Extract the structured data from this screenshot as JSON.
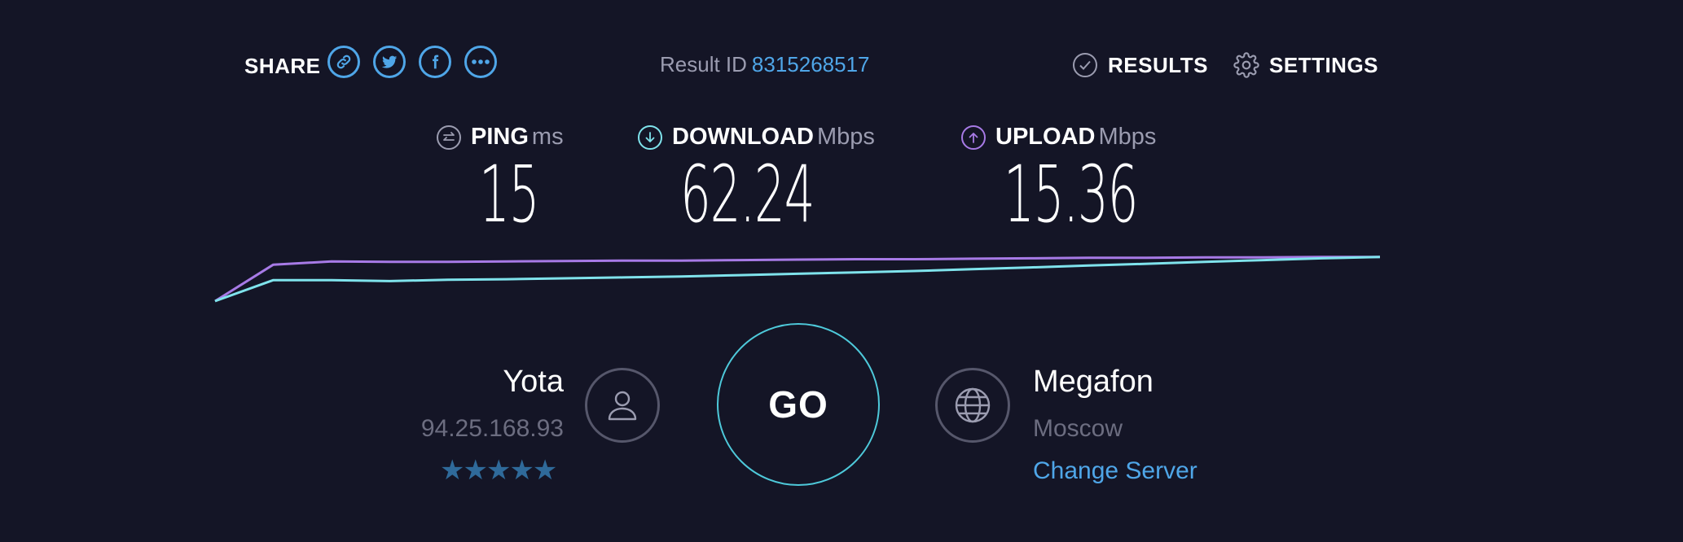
{
  "share": {
    "label": "SHARE",
    "buttons": [
      {
        "name": "link-icon"
      },
      {
        "name": "twitter-icon"
      },
      {
        "name": "facebook-icon"
      },
      {
        "name": "more-icon"
      }
    ]
  },
  "result": {
    "label": "Result ID",
    "id": "8315268517"
  },
  "nav": {
    "results_label": "RESULTS",
    "settings_label": "SETTINGS"
  },
  "metrics": {
    "ping": {
      "title": "PING",
      "unit": "ms",
      "value": "15"
    },
    "download": {
      "title": "DOWNLOAD",
      "unit": "Mbps",
      "value": "62.24"
    },
    "upload": {
      "title": "UPLOAD",
      "unit": "Mbps",
      "value": "15.36"
    }
  },
  "colors": {
    "background": "#141526",
    "accent_blue": "#4fa6e8",
    "download_line": "#7fe3ec",
    "upload_line": "#a77ae6",
    "go_ring": "#4ec9da"
  },
  "isp": {
    "name": "Yota",
    "ip": "94.25.168.93",
    "rating_stars": 5,
    "stars": "★★★★★"
  },
  "go": {
    "label": "GO"
  },
  "server": {
    "name": "Megafon",
    "location": "Moscow",
    "change_label": "Change Server"
  },
  "chart_data": {
    "type": "line",
    "x": [
      0,
      1,
      2,
      3,
      4,
      5,
      6,
      7,
      8,
      9,
      10,
      11,
      12,
      13,
      14,
      15,
      16,
      17,
      18,
      19,
      20
    ],
    "series": [
      {
        "values": [
          0.0,
          0.8,
          0.87,
          0.86,
          0.86,
          0.87,
          0.88,
          0.89,
          0.89,
          0.9,
          0.91,
          0.92,
          0.92,
          0.93,
          0.94,
          0.95,
          0.95,
          0.96,
          0.96,
          0.97,
          0.97
        ]
      },
      {
        "values": [
          0.0,
          0.46,
          0.46,
          0.44,
          0.47,
          0.48,
          0.5,
          0.52,
          0.54,
          0.57,
          0.6,
          0.63,
          0.66,
          0.7,
          0.74,
          0.78,
          0.82,
          0.86,
          0.9,
          0.94,
          0.97
        ]
      }
    ],
    "xlabel": "",
    "ylabel": "",
    "grid": false
  }
}
